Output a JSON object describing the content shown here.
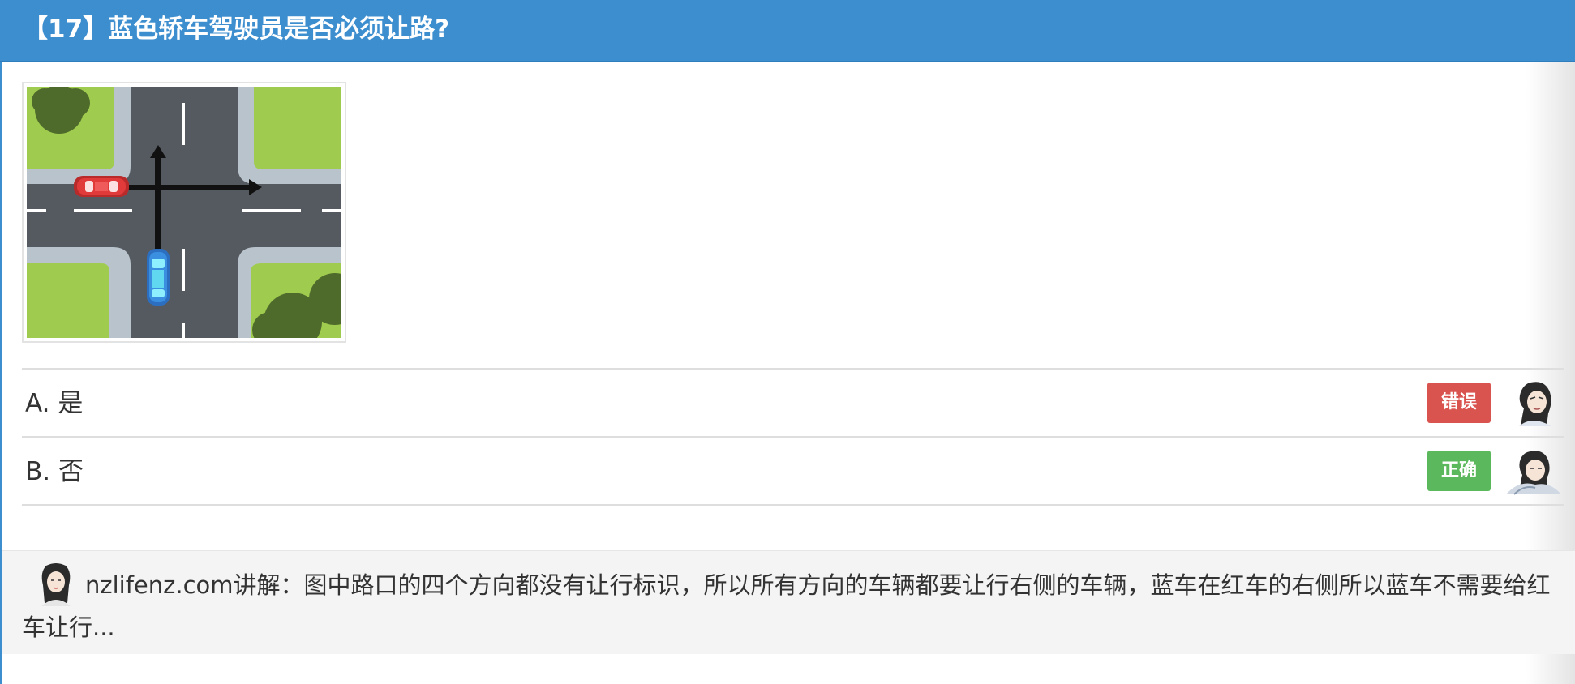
{
  "question": {
    "title": "【17】蓝色轿车驾驶员是否必须让路?"
  },
  "options": [
    {
      "text": "A. 是",
      "badge": "错误",
      "badge_color": "#d9534f"
    },
    {
      "text": "B. 否",
      "badge": "正确",
      "badge_color": "#5cb85c"
    }
  ],
  "explanation": {
    "text": "nzlifenz.com讲解：图中路口的四个方向都没有让行标识，所以所有方向的车辆都要让行右侧的车辆，蓝车在红车的右侧所以蓝车不需要给红车让行..."
  },
  "colors": {
    "header_bg": "#3d8ecf",
    "road": "#555a60",
    "sidewalk": "#b9c3cc",
    "grass": "#9fcc4f",
    "tree": "#4f6b2c",
    "red_car": "#e03a3a",
    "blue_car": "#3a8fe0"
  },
  "icons": {
    "avatar": "cartoon-person-avatar",
    "intersection": "intersection-diagram"
  }
}
